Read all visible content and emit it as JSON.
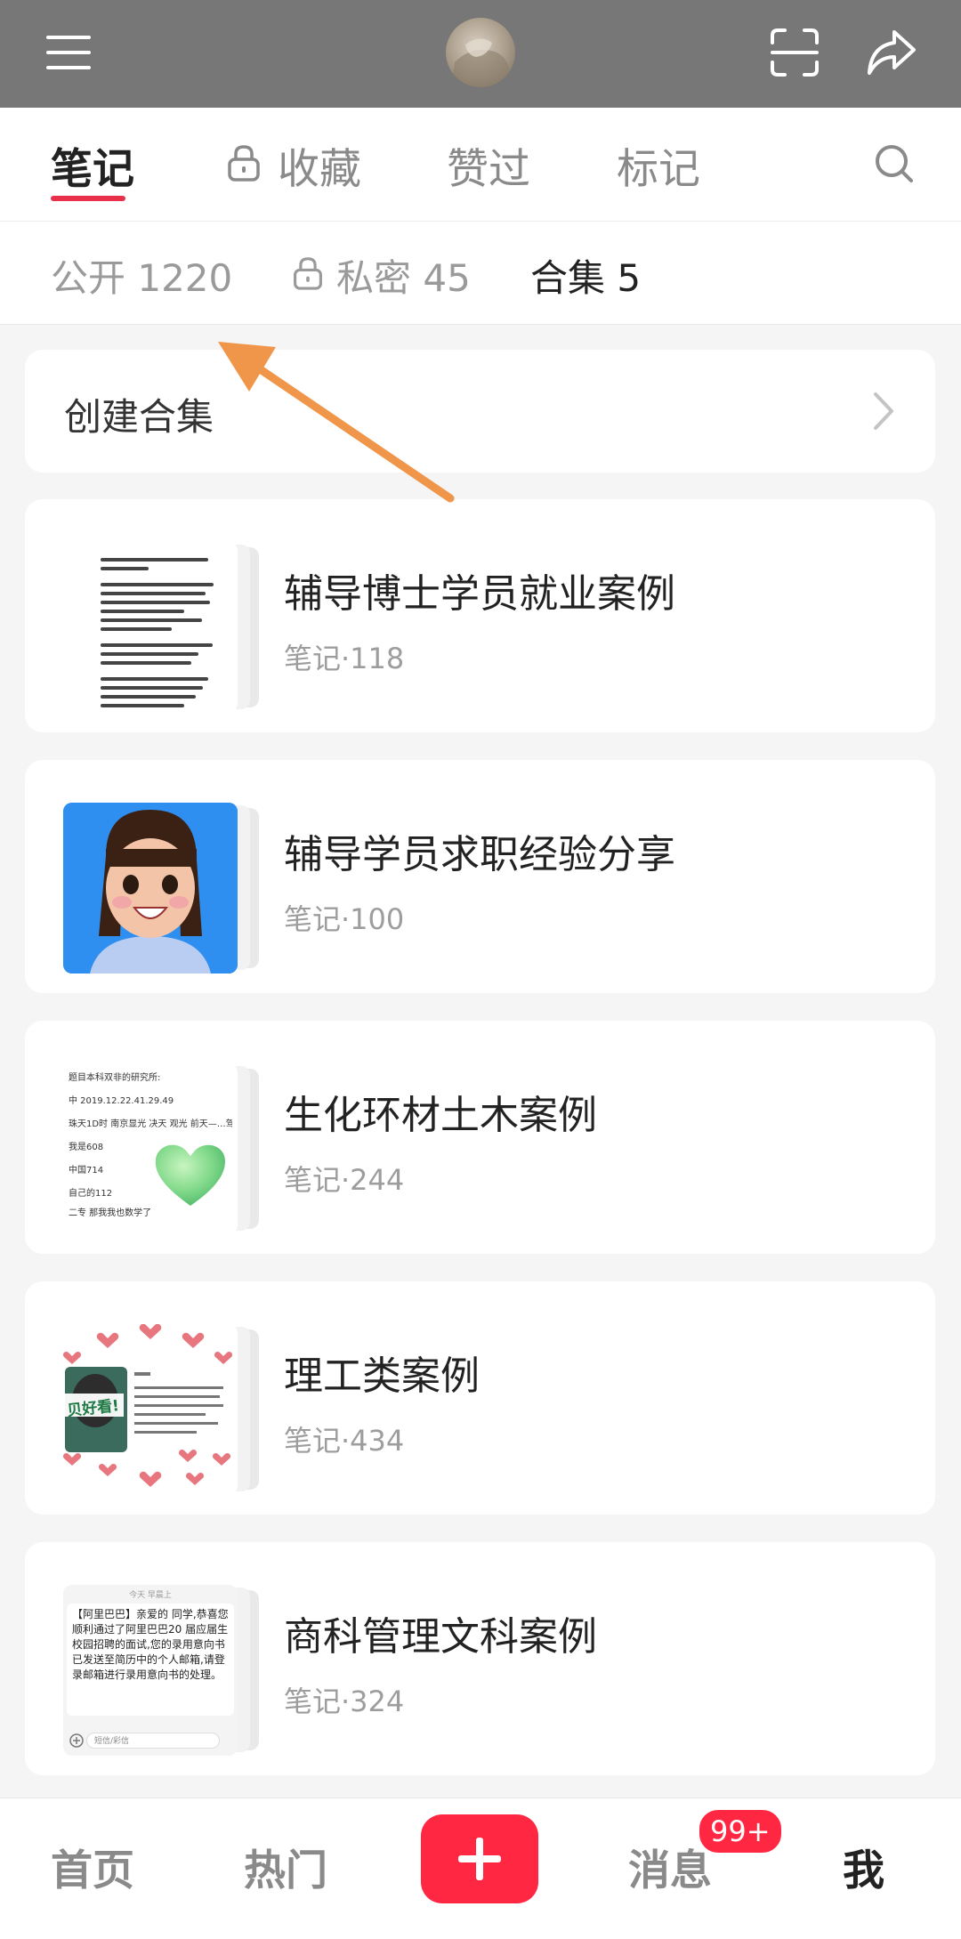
{
  "top_bar": {
    "menu_icon": "menu-icon",
    "scan_icon": "scan-icon",
    "share_icon": "share-icon"
  },
  "tabs": [
    {
      "label": "笔记",
      "active": true
    },
    {
      "label": "收藏",
      "locked": true
    },
    {
      "label": "赞过"
    },
    {
      "label": "标记"
    }
  ],
  "subtabs": [
    {
      "label": "公开 1220"
    },
    {
      "label": "私密 45",
      "locked": true
    },
    {
      "label": "合集 5",
      "active": true
    }
  ],
  "create_collection": {
    "label": "创建合集"
  },
  "collections": [
    {
      "title": "辅导博士学员就业案例",
      "count": "笔记·118",
      "thumb": "document"
    },
    {
      "title": "辅导学员求职经验分享",
      "count": "笔记·100",
      "thumb": "cartoon-girl"
    },
    {
      "title": "生化环材土木案例",
      "count": "笔记·244",
      "thumb": "text-green-heart"
    },
    {
      "title": "理工类案例",
      "count": "笔记·434",
      "thumb": "hearts-photo"
    },
    {
      "title": "商科管理文科案例",
      "count": "笔记·324",
      "thumb": "chat-offer"
    }
  ],
  "thumb_text": {
    "t3": [
      "题目本科双非的研究所:",
      "中 2019.12.22.41.29.49",
      "珠天1D时 南京显光 决天 观光 前天—…驾",
      "我是608",
      "中国714",
      "自己的112",
      "二专 那我我也数学了"
    ],
    "t4_label": "贝好看!",
    "t5": "【阿里巴巴】亲爱的 同学,恭喜您顺利通过了阿里巴巴20 届应届生校园招聘的面试,您的录用意向书已发送至简历中的个人邮箱,请登录邮箱进行录用意向书的处理。",
    "t5_header": "今天 早晨上",
    "t5_input": "短信/彩信"
  },
  "bottom_nav": {
    "home": "首页",
    "hot": "热门",
    "messages": "消息",
    "messages_badge": "99+",
    "me": "我"
  },
  "colors": {
    "accent": "#ff2741",
    "topbar": "#777777",
    "annotation_arrow": "#f0964a"
  }
}
